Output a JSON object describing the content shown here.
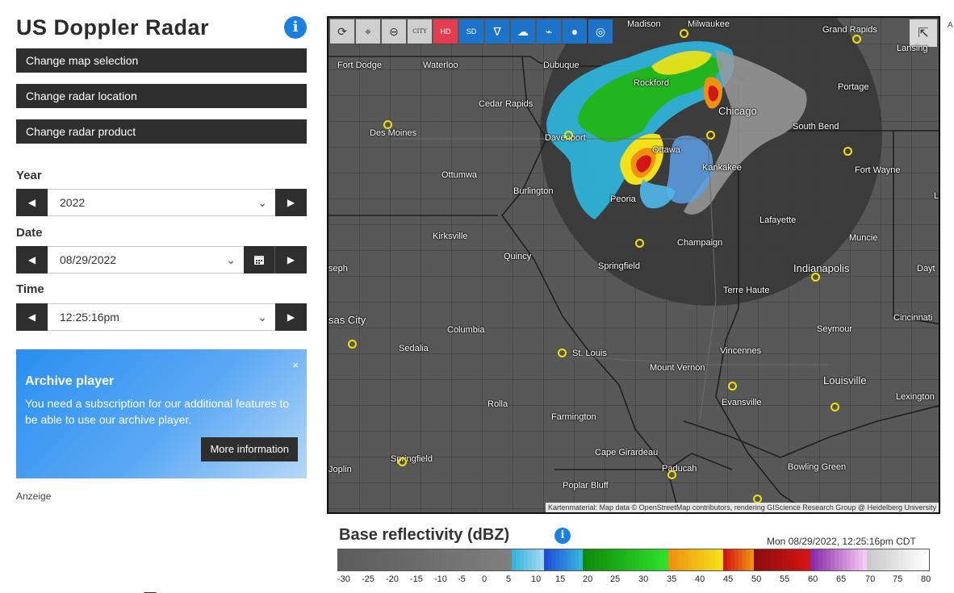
{
  "header": {
    "title": "US Doppler Radar",
    "info_icon": "info-icon"
  },
  "menu": {
    "change_map": "Change map selection",
    "change_location": "Change radar location",
    "change_product": "Change radar product"
  },
  "year": {
    "label": "Year",
    "value": "2022"
  },
  "date": {
    "label": "Date",
    "value": "08/29/2022"
  },
  "time": {
    "label": "Time",
    "value": "12:25:16pm"
  },
  "promo": {
    "title": "Archive player",
    "text": "You need a subscription for our additional features to be able to use our archive player.",
    "button": "More information",
    "close": "×"
  },
  "ad_label": "Anzeige",
  "page_dots": "-----",
  "edge_letter": "A",
  "map": {
    "tools": [
      "refresh-icon",
      "location-pin-icon",
      "zoom-out-icon",
      "city-labels-icon",
      "radar-hd-icon",
      "radar-sd-icon",
      "tornado-icon",
      "storm-icon",
      "satellite-icon",
      "rain-drop-icon",
      "hurricane-icon"
    ],
    "tool_text": {
      "hd": "HD",
      "sd": "SD",
      "city": "CITY"
    },
    "attribution": "Kartenmaterial: Map data © OpenStreetMap contributors, rendering GIScience Research Group @ Heidelberg University",
    "cities": [
      "Madison",
      "Milwaukee",
      "Grand Rapids",
      "Lansing",
      "Fort Dodge",
      "Waterloo",
      "Dubuque",
      "Rockford",
      "Portage",
      "Cedar Rapids",
      "Chicago",
      "South Bend",
      "Des Moines",
      "Davenport",
      "Ottawa",
      "Fort Wayne",
      "Kankakee",
      "Ottumwa",
      "Burlington",
      "Peoria",
      "Lafayette",
      "Lir",
      "Kirksville",
      "Champaign",
      "Muncie",
      "Quincy",
      "Springfield",
      "Indianapolis",
      "seph",
      "Dayt",
      "Terre Haute",
      "sas City",
      "Columbia",
      "Seymour",
      "Cincinnati",
      "Sedalia",
      "St. Louis",
      "Vincennes",
      "Mount Vernon",
      "Louisville",
      "Evansville",
      "Rolla",
      "Lexington",
      "Farmington",
      "Cape Girardeau",
      "Springfield",
      "Joplin",
      "Paducah",
      "Bowling Green",
      "Poplar Bluff"
    ]
  },
  "legend": {
    "title": "Base reflectivity (dBZ)",
    "timestamp": "Mon 08/29/2022, 12:25:16pm CDT",
    "ticks": [
      "-30",
      "-25",
      "-20",
      "-15",
      "-10",
      "-5",
      "0",
      "5",
      "10",
      "15",
      "20",
      "25",
      "30",
      "35",
      "40",
      "45",
      "50",
      "55",
      "60",
      "65",
      "70",
      "75",
      "80"
    ],
    "colors": {
      "grey": "#7f7f7f",
      "cyan": "#35b4e0",
      "blue": "#1f4fd8",
      "green": "#19b814",
      "yellow": "#f3e21a",
      "orange": "#f09010",
      "red": "#d41515",
      "pink": "#e08fe0",
      "purple": "#8a2aa8",
      "white": "#f4f4f4"
    }
  }
}
